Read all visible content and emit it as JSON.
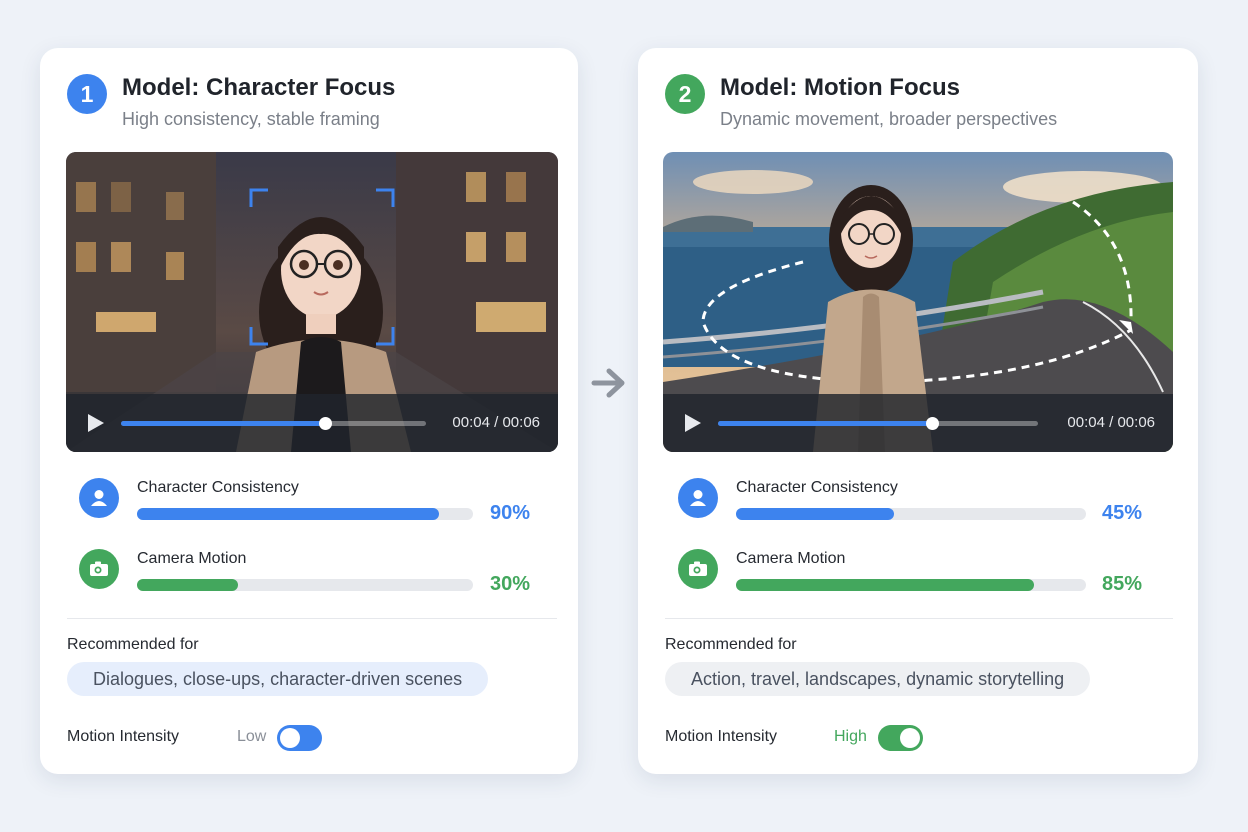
{
  "colors": {
    "blue": "#3d83ee",
    "green": "#43a75d",
    "track": "#e6e8ec",
    "blue_pill_bg": "#e6eefc",
    "gray_pill_bg": "#eef0f3"
  },
  "arrow_icon": "arrow-right-icon",
  "cards": [
    {
      "number": "1",
      "title": "Model: Character Focus",
      "subtitle": "High consistency, stable framing",
      "player": {
        "time": "00:04 / 00:06",
        "progress": 0.67,
        "play_icon": "play-icon"
      },
      "metrics": [
        {
          "label": "Character Consistency",
          "value": "90%",
          "level": 0.9,
          "icon": "user-icon"
        },
        {
          "label": "Camera Motion",
          "value": "30%",
          "level": 0.3,
          "icon": "camera-icon"
        }
      ],
      "recommended_label": "Recommended for",
      "recommended_text": "Dialogues, close-ups, character-driven scenes",
      "intensity_label": "Motion Intensity",
      "intensity_value": "Low",
      "intensity_on": false
    },
    {
      "number": "2",
      "title": "Model: Motion Focus",
      "subtitle": "Dynamic movement, broader perspectives",
      "player": {
        "time": "00:04 / 00:06",
        "progress": 0.67,
        "play_icon": "play-icon"
      },
      "metrics": [
        {
          "label": "Character Consistency",
          "value": "45%",
          "level": 0.45,
          "icon": "user-icon"
        },
        {
          "label": "Camera Motion",
          "value": "85%",
          "level": 0.85,
          "icon": "camera-icon"
        }
      ],
      "recommended_label": "Recommended for",
      "recommended_text": "Action, travel, landscapes, dynamic storytelling",
      "intensity_label": "Motion Intensity",
      "intensity_value": "High",
      "intensity_on": true
    }
  ]
}
